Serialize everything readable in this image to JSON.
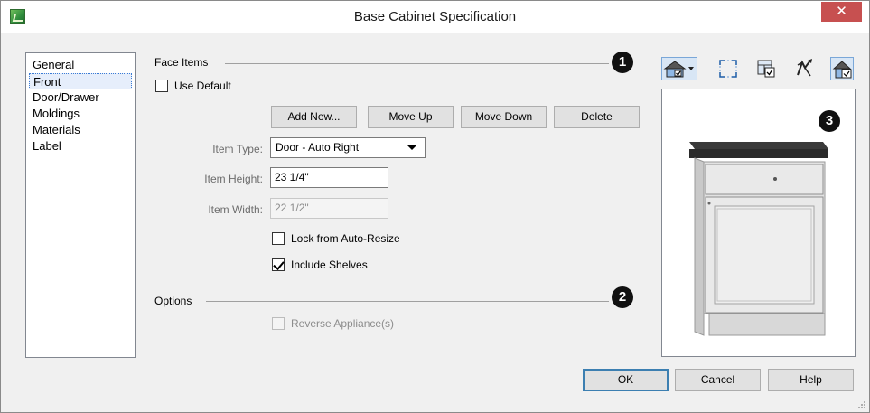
{
  "window": {
    "title": "Base Cabinet Specification",
    "close_glyph": "✕"
  },
  "categories": [
    {
      "label": "General",
      "selected": false
    },
    {
      "label": "Front",
      "selected": true
    },
    {
      "label": "Door/Drawer",
      "selected": false
    },
    {
      "label": "Moldings",
      "selected": false
    },
    {
      "label": "Materials",
      "selected": false
    },
    {
      "label": "Label",
      "selected": false
    }
  ],
  "face_items": {
    "section_label": "Face Items",
    "marker": "1",
    "use_default_label": "Use Default",
    "use_default_checked": false,
    "buttons": {
      "add_new": "Add New...",
      "move_up": "Move Up",
      "move_down": "Move Down",
      "delete": "Delete"
    },
    "item_type_label": "Item Type:",
    "item_type_value": "Door - Auto Right",
    "item_height_label": "Item Height:",
    "item_height_value": "23 1/4\"",
    "item_width_label": "Item Width:",
    "item_width_value": "22 1/2\"",
    "lock_label": "Lock from Auto-Resize",
    "lock_checked": false,
    "shelves_label": "Include Shelves",
    "shelves_checked": true
  },
  "options": {
    "section_label": "Options",
    "marker": "2",
    "reverse_label": "Reverse Appliance(s)",
    "reverse_checked": false
  },
  "preview": {
    "marker": "3",
    "toolbar_icons": [
      "render-mode-icon",
      "fill-window-icon",
      "show-dimensions-icon",
      "rotate-view-icon",
      "cabinet-view-icon"
    ]
  },
  "footer": {
    "ok": "OK",
    "cancel": "Cancel",
    "help": "Help"
  },
  "colors": {
    "close_red": "#c75050",
    "accent_blue": "#3c7fb1",
    "dialog_bg": "#f0f0f0"
  }
}
